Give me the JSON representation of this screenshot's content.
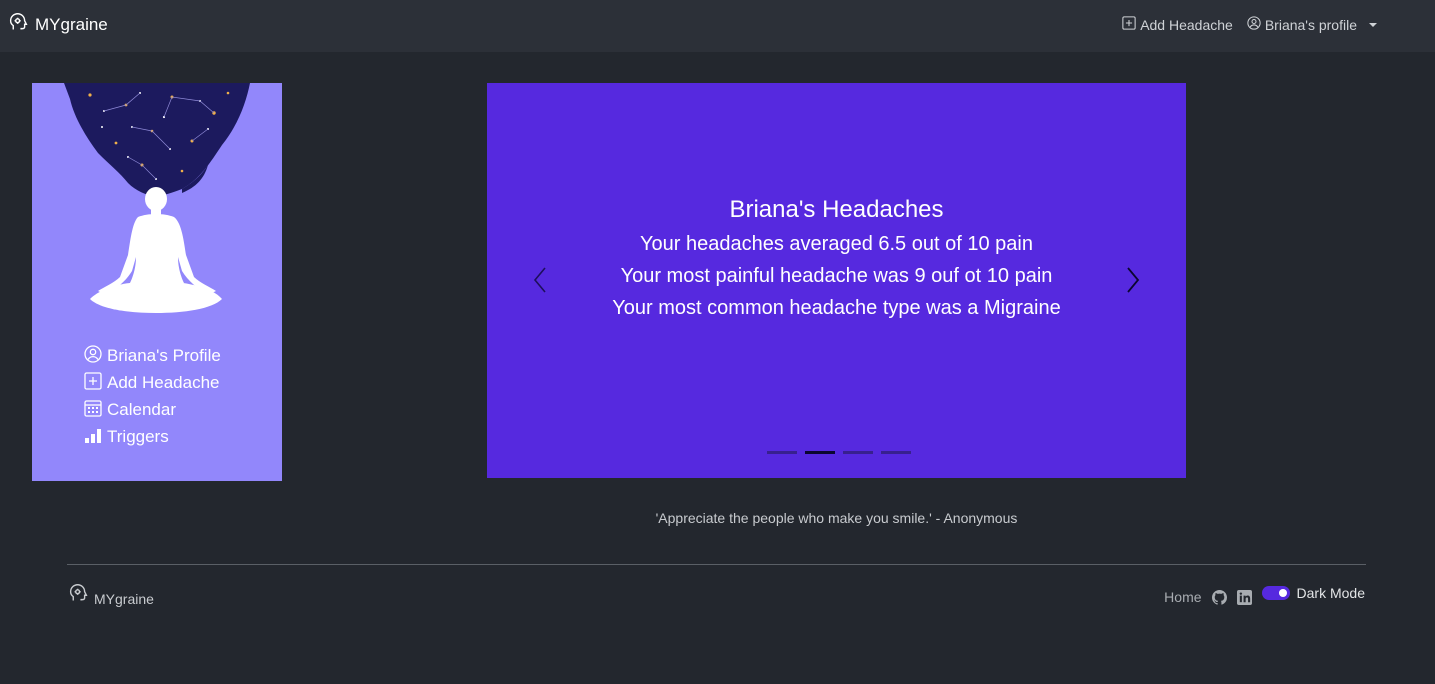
{
  "navbar": {
    "brand": "MYgraine",
    "add_headache": "Add Headache",
    "profile": "Briana's profile"
  },
  "sidebar": {
    "items": [
      {
        "label": "Briana's Profile",
        "icon": "user-circle-icon"
      },
      {
        "label": "Add Headache",
        "icon": "plus-square-icon"
      },
      {
        "label": "Calendar",
        "icon": "calendar-icon"
      },
      {
        "label": "Triggers",
        "icon": "bar-chart-icon"
      }
    ]
  },
  "carousel": {
    "title": "Briana's Headaches",
    "lines": [
      "Your headaches averaged 6.5 out of 10 pain",
      "Your most painful headache was 9 ouf ot 10 pain",
      "Your most common headache type was a Migraine"
    ],
    "indicator_count": 4,
    "active_indicator": 2
  },
  "quote": "'Appreciate the people who make you smile.' - Anonymous",
  "footer": {
    "brand": "MYgraine",
    "home": "Home",
    "dark_mode_label": "Dark Mode",
    "dark_mode_on": true
  },
  "colors": {
    "background": "#23272e",
    "navbar": "#2c3038",
    "sidebar": "#9287fb",
    "carousel": "#5629df",
    "toggle": "#5629df"
  }
}
